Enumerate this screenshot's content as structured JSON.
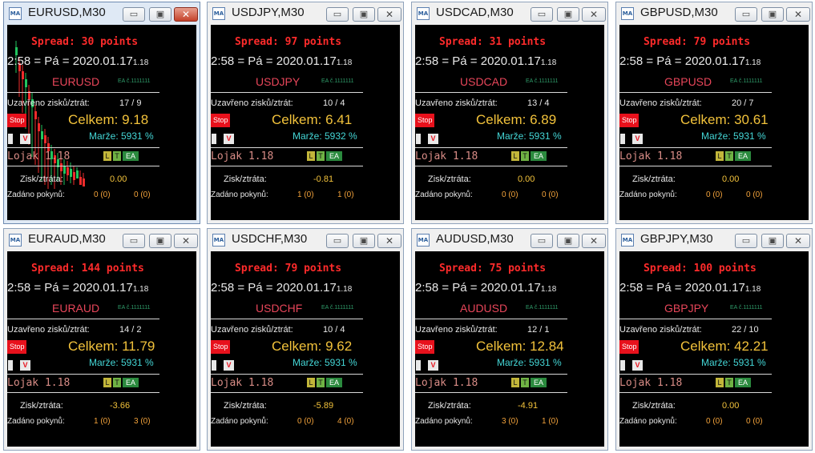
{
  "windows": [
    {
      "title": "EURUSD,M30",
      "active": true,
      "spread": "Spread: 30 points",
      "time": "2:58 = Pá = 2020.01.17",
      "version": "1.18",
      "symbol": "EURUSD",
      "ea_number": "EA č.1111111",
      "closed_label": "Uzavřeno zisků/ztrát:",
      "closed_value": "17 / 9",
      "stop_label": "Stop",
      "total": "Celkem: 9.18",
      "margin": "Marže: 5931 %",
      "v_label": "V",
      "lot": "Lojak 1.18",
      "tags": [
        "L",
        "T",
        "€",
        "EA"
      ],
      "pl_label": "Zisk/ztráta:",
      "pl_value": "0.00",
      "orders_label": "Zadáno pokynů:",
      "orders_a": "0 (0)",
      "orders_b": "0 (0)"
    },
    {
      "title": "USDJPY,M30",
      "active": false,
      "spread": "Spread: 97 points",
      "time": "2:58 = Pá = 2020.01.17",
      "version": "1.18",
      "symbol": "USDJPY",
      "ea_number": "EA č.1111111",
      "closed_label": "Uzavřeno zisků/ztrát:",
      "closed_value": "10 / 4",
      "stop_label": "Stop",
      "total": "Celkem: 6.41",
      "margin": "Marže: 5932 %",
      "v_label": "V",
      "lot": "Lojak 1.18",
      "tags": [
        "L",
        "T",
        "€",
        "EA"
      ],
      "pl_label": "Zisk/ztráta:",
      "pl_value": "-0.81",
      "orders_label": "Zadáno pokynů:",
      "orders_a": "1 (0)",
      "orders_b": "1 (0)"
    },
    {
      "title": "USDCAD,M30",
      "active": false,
      "spread": "Spread: 31 points",
      "time": "2:58 = Pá = 2020.01.17",
      "version": "1.18",
      "symbol": "USDCAD",
      "ea_number": "EA č.1111111",
      "closed_label": "Uzavřeno zisků/ztrát:",
      "closed_value": "13 / 4",
      "stop_label": "Stop",
      "total": "Celkem: 6.89",
      "margin": "Marže: 5931 %",
      "v_label": "V",
      "lot": "Lojak 1.18",
      "tags": [
        "L",
        "T",
        "€",
        "EA"
      ],
      "pl_label": "Zisk/ztráta:",
      "pl_value": "0.00",
      "orders_label": "Zadáno pokynů:",
      "orders_a": "0 (0)",
      "orders_b": "0 (0)"
    },
    {
      "title": "GBPUSD,M30",
      "active": false,
      "spread": "Spread: 79 points",
      "time": "2:58 = Pá = 2020.01.17",
      "version": "1.18",
      "symbol": "GBPUSD",
      "ea_number": "EA č.1111111",
      "closed_label": "Uzavřeno zisků/ztrát:",
      "closed_value": "20 / 7",
      "stop_label": "Stop",
      "total": "Celkem: 30.61",
      "margin": "Marže: 5931 %",
      "v_label": "V",
      "lot": "Lojak 1.18",
      "tags": [
        "L",
        "T",
        "€",
        "EA"
      ],
      "pl_label": "Zisk/ztráta:",
      "pl_value": "0.00",
      "orders_label": "Zadáno pokynů:",
      "orders_a": "0 (0)",
      "orders_b": "0 (0)"
    },
    {
      "title": "EURAUD,M30",
      "active": false,
      "spread": "Spread: 144 points",
      "time": "2:58 = Pá = 2020.01.17",
      "version": "1.18",
      "symbol": "EURAUD",
      "ea_number": "EA č.1111111",
      "closed_label": "Uzavřeno zisků/ztrát:",
      "closed_value": "14 / 2",
      "stop_label": "Stop",
      "total": "Celkem: 11.79",
      "margin": "Marže: 5931 %",
      "v_label": "V",
      "lot": "Lojak 1.18",
      "tags": [
        "L",
        "T",
        "€",
        "EA"
      ],
      "pl_label": "Zisk/ztráta:",
      "pl_value": "-3.66",
      "orders_label": "Zadáno pokynů:",
      "orders_a": "1 (0)",
      "orders_b": "3 (0)"
    },
    {
      "title": "USDCHF,M30",
      "active": false,
      "spread": "Spread: 79 points",
      "time": "2:58 = Pá = 2020.01.17",
      "version": "1.18",
      "symbol": "USDCHF",
      "ea_number": "EA č.1111111",
      "closed_label": "Uzavřeno zisků/ztrát:",
      "closed_value": "10 / 4",
      "stop_label": "Stop",
      "total": "Celkem: 9.62",
      "margin": "Marže: 5931 %",
      "v_label": "V",
      "lot": "Lojak 1.18",
      "tags": [
        "L",
        "T",
        "€",
        "EA"
      ],
      "pl_label": "Zisk/ztráta:",
      "pl_value": "-5.89",
      "orders_label": "Zadáno pokynů:",
      "orders_a": "0 (0)",
      "orders_b": "4 (0)"
    },
    {
      "title": "AUDUSD,M30",
      "active": false,
      "spread": "Spread: 75 points",
      "time": "2:58 = Pá = 2020.01.17",
      "version": "1.18",
      "symbol": "AUDUSD",
      "ea_number": "EA č.1111111",
      "closed_label": "Uzavřeno zisků/ztrát:",
      "closed_value": "12 / 1",
      "stop_label": "Stop",
      "total": "Celkem: 12.84",
      "margin": "Marže: 5931 %",
      "v_label": "V",
      "lot": "Lojak 1.18",
      "tags": [
        "L",
        "T",
        "€",
        "EA"
      ],
      "pl_label": "Zisk/ztráta:",
      "pl_value": "-4.91",
      "orders_label": "Zadáno pokynů:",
      "orders_a": "3 (0)",
      "orders_b": "1 (0)"
    },
    {
      "title": "GBPJPY,M30",
      "active": false,
      "spread": "Spread: 100 points",
      "time": "2:58 = Pá = 2020.01.17",
      "version": "1.18",
      "symbol": "GBPJPY",
      "ea_number": "EA č.1111111",
      "closed_label": "Uzavřeno zisků/ztrát:",
      "closed_value": "22 / 10",
      "stop_label": "Stop",
      "total": "Celkem: 42.21",
      "margin": "Marže: 5931 %",
      "v_label": "V",
      "lot": "Lojak 1.18",
      "tags": [
        "L",
        "T",
        "€",
        "EA"
      ],
      "pl_label": "Zisk/ztráta:",
      "pl_value": "0.00",
      "orders_label": "Zadáno pokynů:",
      "orders_a": "0 (0)",
      "orders_b": "0 (0)"
    }
  ],
  "window_controls": {
    "minimize": "▭",
    "maximize": "▣",
    "close": "✕",
    "icon_text": "MA"
  },
  "colors": {
    "spread": "#ff2b2b",
    "total": "#f2c23b",
    "margin": "#44d6d6",
    "symbol": "#e8465a",
    "bull_candle": "#22c55e",
    "bear_candle": "#ef2b2b"
  }
}
